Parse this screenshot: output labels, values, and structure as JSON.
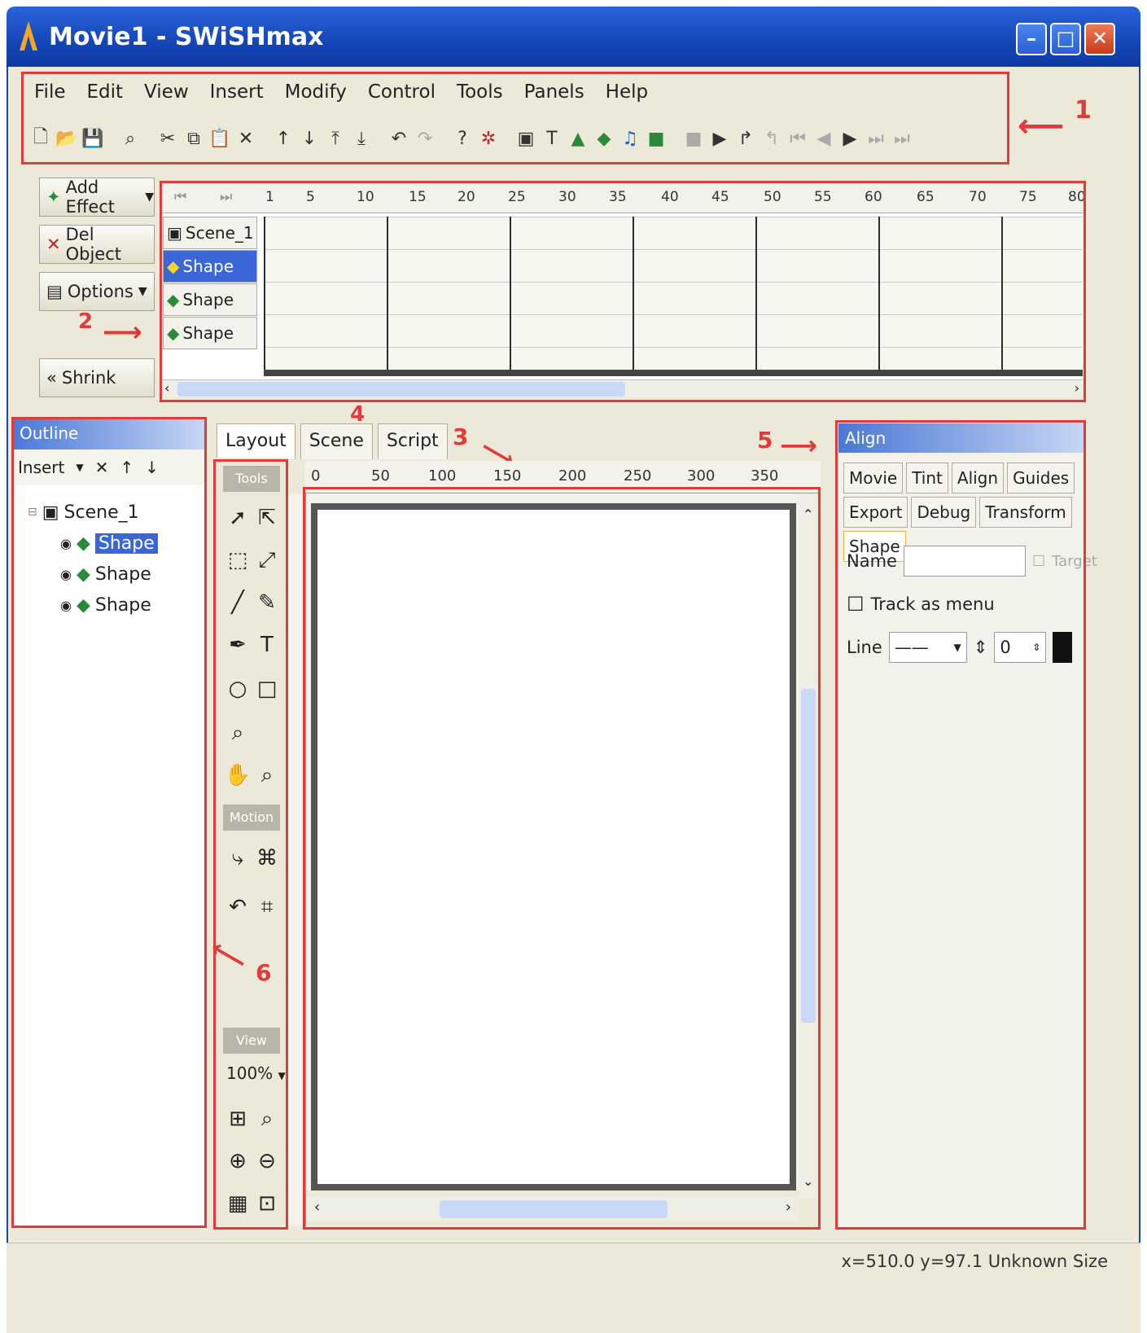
{
  "window": {
    "title": "Movie1 - SWiSHmax"
  },
  "menu": [
    "File",
    "Edit",
    "View",
    "Insert",
    "Modify",
    "Control",
    "Tools",
    "Panels",
    "Help"
  ],
  "toolbar_icons": [
    "new-icon",
    "open-icon",
    "save-icon",
    "find-icon",
    "cut-icon",
    "copy-icon",
    "paste-icon",
    "delete-icon",
    "move-up-icon",
    "move-down-icon",
    "bring-front-icon",
    "send-back-icon",
    "undo-icon",
    "redo-icon",
    "help-icon",
    "debug-icon",
    "insert-scene-icon",
    "insert-text-icon",
    "insert-image-icon",
    "insert-sprite-icon",
    "insert-content-icon",
    "insert-button-icon",
    "stop-icon",
    "play-icon",
    "play-timeline-icon",
    "rewind-icon",
    "step-back-icon",
    "step-forward-icon",
    "play-effect-icon",
    "last-frame-icon",
    "end-icon"
  ],
  "timeline": {
    "add_effect_label": "Add Effect",
    "del_object_label": "Del Object",
    "options_label": "Options",
    "shrink_label": "Shrink",
    "ruler_labels": [
      "1",
      "5",
      "10",
      "15",
      "20",
      "25",
      "30",
      "35",
      "40",
      "45",
      "50",
      "55",
      "60",
      "65",
      "70",
      "75",
      "80"
    ],
    "layers": [
      {
        "label": "Scene_1",
        "selected": false
      },
      {
        "label": "Shape",
        "selected": true
      },
      {
        "label": "Shape",
        "selected": false
      },
      {
        "label": "Shape",
        "selected": false
      }
    ]
  },
  "outline_panel": {
    "title": "Outline",
    "insert_label": "Insert",
    "tree": [
      {
        "label": "Scene_1",
        "level": 0,
        "selected": false
      },
      {
        "label": "Shape",
        "level": 1,
        "selected": true
      },
      {
        "label": "Shape",
        "level": 1,
        "selected": false
      },
      {
        "label": "Shape",
        "level": 1,
        "selected": false
      }
    ]
  },
  "stage_tabs": [
    "Layout",
    "Scene",
    "Script"
  ],
  "stage_active_tab": "Layout",
  "hruler_labels": [
    "0",
    "50",
    "100",
    "150",
    "200",
    "250",
    "300",
    "350"
  ],
  "tools": {
    "groups": [
      "Tools",
      "Motion",
      "View"
    ],
    "zoom_label": "100%"
  },
  "properties_panel": {
    "title": "Align",
    "tabs_row1": [
      "Movie",
      "Tint",
      "Align",
      "Guides"
    ],
    "tabs_row2": [
      "Export",
      "Debug",
      "Transform",
      "Shape"
    ],
    "active_tab": "Shape",
    "name_label": "Name",
    "name_value": "",
    "target_label": "Target",
    "track_as_menu_label": "Track as menu",
    "line_label": "Line",
    "line_width_value": "0"
  },
  "status": {
    "text": "x=510.0 y=97.1  Unknown Size"
  },
  "annotations": [
    "1",
    "2",
    "3",
    "4",
    "5",
    "6"
  ],
  "colors": {
    "annotation": "#e03a3a",
    "titlebar": "#1446b8",
    "selection": "#3a66d8"
  }
}
